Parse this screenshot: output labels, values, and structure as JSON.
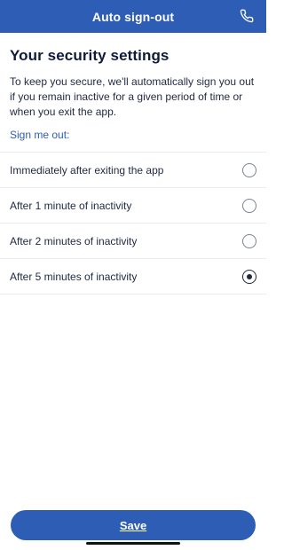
{
  "header": {
    "title": "Auto sign-out",
    "phone_icon": "phone-icon"
  },
  "main": {
    "title": "Your security settings",
    "intro": "To keep you secure, we'll automatically sign you out if you remain inactive for a given period of time or when you exit the app.",
    "subtitle": "Sign me out:"
  },
  "options": [
    {
      "label": "Immediately after exiting the app",
      "selected": false
    },
    {
      "label": "After 1 minute of inactivity",
      "selected": false
    },
    {
      "label": "After 2 minutes of inactivity",
      "selected": false
    },
    {
      "label": "After 5 minutes of inactivity",
      "selected": true
    }
  ],
  "footer": {
    "save_label": "Save"
  },
  "colors": {
    "brand": "#2d5db4",
    "text": "#1f2940",
    "divider": "#e9ecf1"
  }
}
